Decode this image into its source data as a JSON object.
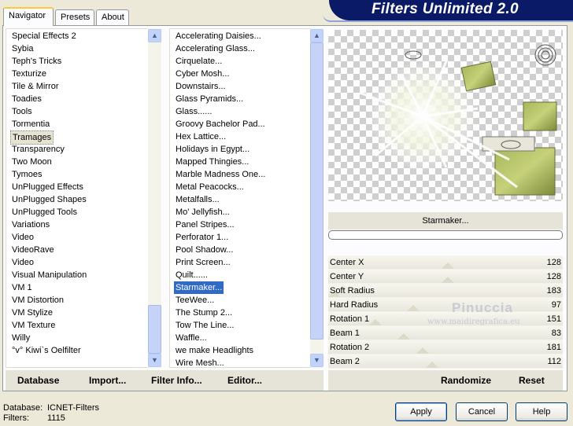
{
  "tabs": [
    {
      "label": "Navigator"
    },
    {
      "label": "Presets"
    },
    {
      "label": "About"
    }
  ],
  "banner_title": "Filters Unlimited 2.0",
  "categories": [
    "Special Effects 2",
    "Sybia",
    "Teph's Tricks",
    "Texturize",
    "Tile & Mirror",
    "Toadies",
    "Tools",
    "Tormentia",
    "Tramages",
    "Transparency",
    "Two Moon",
    "Tymoes",
    "UnPlugged Effects",
    "UnPlugged Shapes",
    "UnPlugged Tools",
    "Variations",
    "Video",
    "VideoRave",
    "Video",
    "Visual Manipulation",
    "VM 1",
    "VM Distortion",
    "VM Stylize",
    "VM Texture",
    "Willy",
    "°v° Kiwi`s Oelfilter"
  ],
  "filters": [
    "Accelerating Daisies...",
    "Accelerating Glass...",
    "Cirquelate...",
    "Cyber Mosh...",
    "Downstairs...",
    "Glass Pyramids...",
    "Glass......",
    "Groovy Bachelor Pad...",
    "Hex Lattice...",
    "Holidays in Egypt...",
    "Mapped Thingies...",
    "Marble Madness One...",
    "Metal Peacocks...",
    "Metalfalls...",
    "Mo' Jellyfish...",
    "Panel Stripes...",
    "Perforator 1...",
    "Pool Shadow...",
    "Print Screen...",
    "Quilt......",
    "Starmaker...",
    "TeeWee...",
    "The Stump 2...",
    "Tow The Line...",
    "Waffle...",
    "we make Headlights",
    "Wire Mesh..."
  ],
  "selected_filter_label": "Starmaker...",
  "params": [
    {
      "name": "Center X",
      "value": "128"
    },
    {
      "name": "Center Y",
      "value": "128"
    },
    {
      "name": "Soft Radius",
      "value": "183"
    },
    {
      "name": "Hard Radius",
      "value": "97"
    },
    {
      "name": "Rotation 1",
      "value": "151"
    },
    {
      "name": "Beam 1",
      "value": "83"
    },
    {
      "name": "Rotation 2",
      "value": "181"
    },
    {
      "name": "Beam 2",
      "value": "112"
    }
  ],
  "watermark": {
    "name": "Pinuccia",
    "url": "www.maidiregrafica.eu"
  },
  "bottom_left": {
    "database": "Database",
    "import": "Import...",
    "filter_info": "Filter Info...",
    "editor": "Editor..."
  },
  "bottom_right": {
    "randomize": "Randomize",
    "reset": "Reset"
  },
  "status": {
    "database_label": "Database:",
    "database_value": "ICNET-Filters",
    "filters_label": "Filters:",
    "filters_value": "1115"
  },
  "buttons": {
    "apply": "Apply",
    "cancel": "Cancel",
    "help": "Help"
  },
  "colors": {
    "selection": "#316ac5",
    "banner": "#0a1a66",
    "accent_tab": "#ffc83c"
  }
}
